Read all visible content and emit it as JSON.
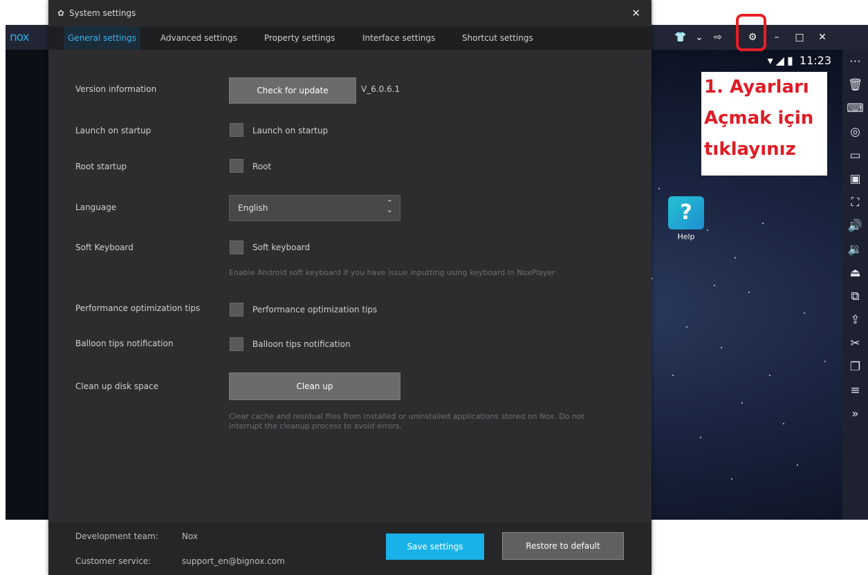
{
  "emulator": {
    "logo_text": "nox",
    "titlebar_controls": [
      "👕",
      "⌄",
      "⇨",
      "⚙",
      "–",
      "□",
      "✕"
    ],
    "status_time": "11:23",
    "status_icons": [
      "wifi-icon",
      "signal-icon",
      "battery-icon"
    ],
    "desktop_app": {
      "label": "Help",
      "icon_glyph": "?"
    },
    "sidebar_icons": [
      "more-icon",
      "trash-icon",
      "keyboard-icon",
      "location-icon",
      "screenshot-icon",
      "apk-icon",
      "fullscreen-icon",
      "volume-up-icon",
      "volume-down-icon",
      "toolbox-icon",
      "multi-instance-icon",
      "import-icon",
      "scissors-icon",
      "multi-drive-icon",
      "menu-icon",
      "expand-icon"
    ],
    "sidebar_glyphs": [
      "⋯",
      "🗑",
      "⌨",
      "◎",
      "▭",
      "▣",
      "⛶",
      "🔊",
      "🔉",
      "⏏",
      "⧉",
      "⇪",
      "✂",
      "❐",
      "≡",
      "»"
    ]
  },
  "annotation": {
    "lines": [
      "1. Ayarları",
      "Açmak için",
      "tıklayınız"
    ],
    "color": "#e01c25"
  },
  "dialog": {
    "title": "System settings",
    "tabs": [
      "General settings",
      "Advanced settings",
      "Property settings",
      "Interface settings",
      "Shortcut settings"
    ],
    "active_tab": "General settings",
    "version": {
      "label": "Version information",
      "button": "Check for update",
      "value": "V_6.0.6.1"
    },
    "launch": {
      "label": "Launch on startup",
      "checkbox": "Launch on startup",
      "checked": false
    },
    "root": {
      "label": "Root startup",
      "checkbox": "Root",
      "checked": false
    },
    "language": {
      "label": "Language",
      "value": "English"
    },
    "soft_keyboard": {
      "label": "Soft Keyboard",
      "checkbox": "Soft keyboard",
      "checked": false,
      "hint": "Enable Android soft keyboard if you have issue inputting using keyboard in NoxPlayer"
    },
    "performance": {
      "label": "Performance optimization tips",
      "checkbox": "Performance optimization tips",
      "checked": false
    },
    "balloon": {
      "label": "Balloon tips notification",
      "checkbox": "Balloon tips notification",
      "checked": false
    },
    "cleanup": {
      "label": "Clean up disk space",
      "button": "Clean up",
      "hint": "Clear cache and residual files from installed or uninstalled applications stored on Nox. Do not interrupt the cleanup process to avoid errors."
    },
    "footer": {
      "dev_team_label": "Development team:",
      "dev_team_value": "Nox",
      "support_label": "Customer service:",
      "support_value": "support_en@bignox.com",
      "save": "Save settings",
      "restore": "Restore to default"
    },
    "accent_color": "#18b2e8"
  }
}
